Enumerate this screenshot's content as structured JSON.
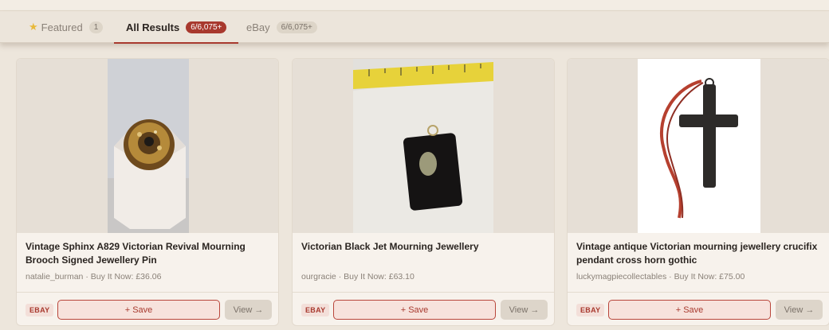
{
  "tabs": [
    {
      "label": "Featured",
      "count": "1",
      "icon": "star-icon"
    },
    {
      "label": "All Results",
      "count": "6/6,075+"
    },
    {
      "label": "eBay",
      "count": "6/6,075+"
    }
  ],
  "colors": {
    "accent": "#a8392e",
    "background": "#ede6dc",
    "card": "#f7f2ec"
  },
  "cards": [
    {
      "title": "Vintage Sphinx A829 Victorian Revival Mourning Brooch Signed Jewellery Pin",
      "seller": "natalie_burman",
      "price_text": "Buy It Now: £36.06",
      "source": "EBAY",
      "save_label": "+ Save",
      "view_label": "View →"
    },
    {
      "title": "Victorian Black Jet Mourning Jewellery",
      "seller": "ourgracie",
      "price_text": "Buy It Now: £63.10",
      "source": "EBAY",
      "save_label": "+ Save",
      "view_label": "View →"
    },
    {
      "title": "Vintage antique Victorian mourning jewellery crucifix pendant cross horn gothic",
      "seller": "luckymagpiecollectables",
      "price_text": "Buy It Now: £75.00",
      "source": "EBAY",
      "save_label": "+ Save",
      "view_label": "View →"
    }
  ]
}
